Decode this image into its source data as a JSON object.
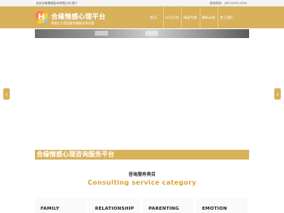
{
  "topbar": {
    "company": "北京合缘情感技术有限公司 旗下",
    "phone": "咨询热线：187-0123-1234"
  },
  "brand": {
    "title": "合缘情感心理平台",
    "subtitle": "帮助亿万家庭解决婚姻关系问题"
  },
  "nav": [
    {
      "label": "首页"
    },
    {
      "label": "公司介绍"
    },
    {
      "label": "情感专题"
    },
    {
      "label": "最新动态"
    },
    {
      "label": "关于我们"
    }
  ],
  "carousel": {
    "prev_icon": "chevron-left-icon",
    "next_icon": "chevron-right-icon",
    "prev_glyph": "‹",
    "next_glyph": "›"
  },
  "platform_banner": "合缘情感心理咨询服务平台",
  "services": {
    "title_cn": "咨询服务类目",
    "title_en": "Consulting service category",
    "categories": [
      {
        "label": "FAMILY"
      },
      {
        "label": "RELATIONSHIP"
      },
      {
        "label": "PARENTING"
      },
      {
        "label": "EMOTION"
      }
    ]
  },
  "colors": {
    "brand_gold": "#d8b15a",
    "accent_text": "#d8a43a"
  }
}
